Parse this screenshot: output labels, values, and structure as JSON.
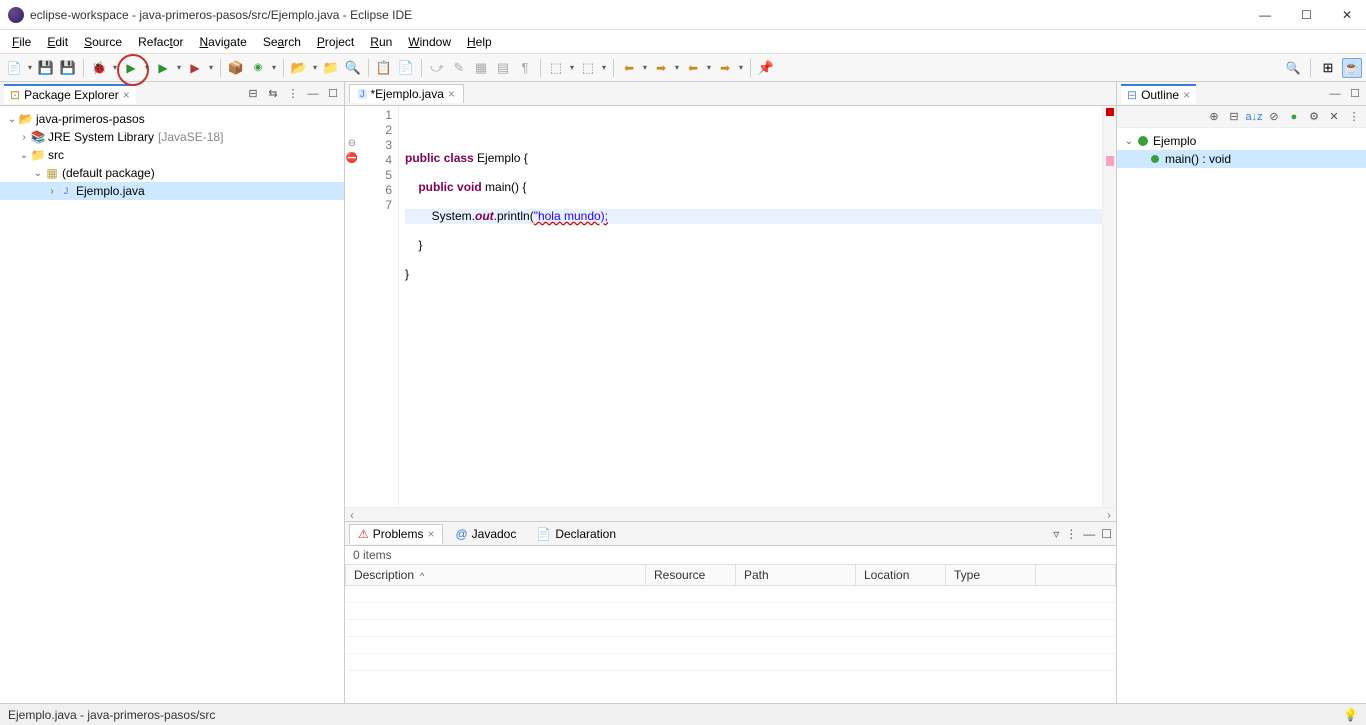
{
  "window": {
    "title": "eclipse-workspace - java-primeros-pasos/src/Ejemplo.java - Eclipse IDE"
  },
  "menu": {
    "file": "File",
    "edit": "Edit",
    "source": "Source",
    "refactor": "Refactor",
    "navigate": "Navigate",
    "search": "Search",
    "project": "Project",
    "run": "Run",
    "window": "Window",
    "help": "Help"
  },
  "package_explorer": {
    "title": "Package Explorer",
    "project": "java-primeros-pasos",
    "jre_lib": "JRE System Library",
    "jre_ver": "[JavaSE-18]",
    "src": "src",
    "default_pkg": "(default package)",
    "file": "Ejemplo.java"
  },
  "editor": {
    "tab_label": "*Ejemplo.java",
    "lines": {
      "l1": "",
      "l2_kw1": "public",
      "l2_kw2": "class",
      "l2_name": " Ejemplo {",
      "l3_kw1": "public",
      "l3_kw2": "void",
      "l3_rest": " main() {",
      "l4_pre": "        System.",
      "l4_out": "out",
      "l4_mid": ".println(",
      "l4_str": "\"hola mundo);",
      "l5": "    }",
      "l6": "}",
      "l7": ""
    },
    "line_numbers": [
      "1",
      "2",
      "3",
      "4",
      "5",
      "6",
      "7"
    ]
  },
  "outline": {
    "title": "Outline",
    "class": "Ejemplo",
    "method": "main() : void"
  },
  "problems": {
    "tab_problems": "Problems",
    "tab_javadoc": "Javadoc",
    "tab_declaration": "Declaration",
    "items_count": "0 items",
    "columns": {
      "description": "Description",
      "resource": "Resource",
      "path": "Path",
      "location": "Location",
      "type": "Type"
    }
  },
  "statusbar": {
    "path": "Ejemplo.java - java-primeros-pasos/src"
  }
}
